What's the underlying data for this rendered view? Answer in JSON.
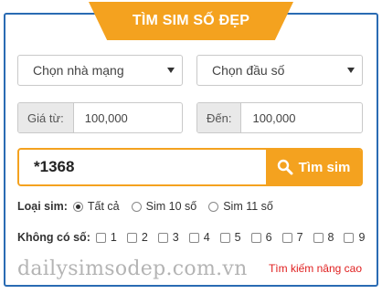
{
  "header": {
    "title": "TÌM SIM SỐ ĐẸP"
  },
  "filters": {
    "carrier": {
      "selected": "Chọn nhà mạng"
    },
    "prefix": {
      "selected": "Chọn đầu số"
    },
    "price_from": {
      "label": "Giá từ:",
      "value": "100,000"
    },
    "price_to": {
      "label": "Đến:",
      "value": "100,000"
    }
  },
  "search": {
    "value": "*1368",
    "button_label": "Tìm sim",
    "accent": "#f4a21f"
  },
  "sim_type": {
    "label": "Loại sim:",
    "options": [
      "Tất cả",
      "Sim 10 số",
      "Sim 11 số"
    ],
    "selected": "Tất cả"
  },
  "exclude_digits": {
    "label": "Không có số:",
    "digits": [
      "1",
      "2",
      "3",
      "4",
      "5",
      "6",
      "7",
      "8",
      "9"
    ]
  },
  "footer": {
    "brand": "dailysimsodep.com.vn",
    "advanced_link": "Tìm kiếm nâng cao"
  }
}
